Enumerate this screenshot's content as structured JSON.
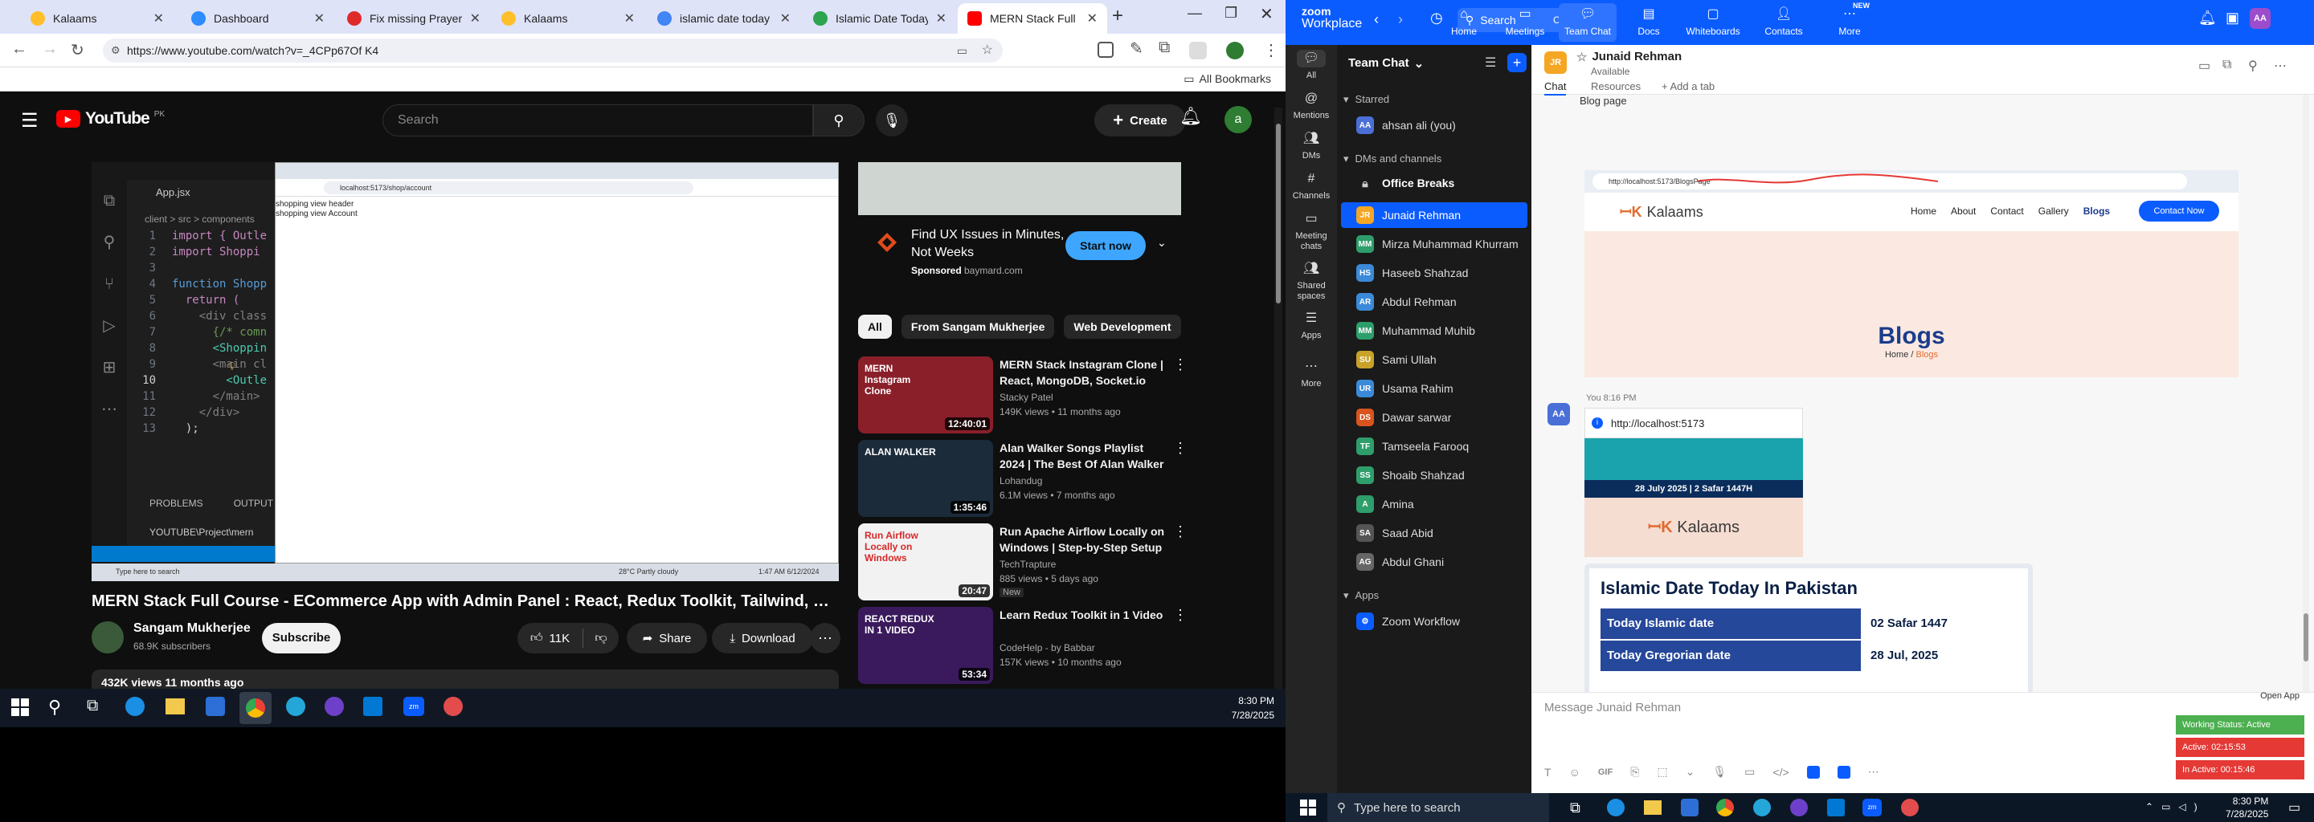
{
  "browser": {
    "tabs": [
      {
        "label": "Kalaams",
        "color": "#ffbf2a"
      },
      {
        "label": "Dashboard",
        "color": "#2d8cff"
      },
      {
        "label": "Fix missing PrayerTime",
        "color": "#e02a2a"
      },
      {
        "label": "Kalaams",
        "color": "#ffbf2a"
      },
      {
        "label": "islamic date today ne",
        "color": "#4285f4"
      },
      {
        "label": "Islamic Date Today - P",
        "color": "#2da44e"
      },
      {
        "label": "MERN Stack Full Cour",
        "color": "#ff0000"
      }
    ],
    "url": "https://www.youtube.com/watch?v=_4CPp67Of K4",
    "all_bookmarks": "All Bookmarks"
  },
  "youtube": {
    "logo": "YouTube",
    "country": "PK",
    "search_placeholder": "Search",
    "create_label": "Create",
    "avatar_letter": "a",
    "video": {
      "title": "MERN Stack Full Course - ECommerce App with Admin Panel : React, Redux Toolkit, Tailwind, MongoDB",
      "channel": "Sangam Mukherjee",
      "subscribers": "68.9K subscribers",
      "subscribe": "Subscribe",
      "likes": "11K",
      "share": "Share",
      "download": "Download",
      "views_age": "432K views  11 months ago"
    },
    "player": {
      "vscode_title": "App.jsx",
      "breadcrumb": "client > src > components",
      "line_numbers": [
        "1",
        "2",
        "3",
        "4",
        "5",
        "6",
        "7",
        "8",
        "9",
        "10",
        "11",
        "12",
        "13"
      ],
      "code": [
        "import { Outle",
        "import Shoppi",
        "",
        "function Shopp",
        "  return (",
        "    <div class",
        "      {/* comn",
        "      <Shoppin",
        "      <main cl",
        "        <Outle",
        "      </main>",
        "    </div>",
        "  );"
      ],
      "panel_tabs": [
        "PROBLEMS",
        "OUTPUT"
      ],
      "terminal": "YOUTUBE\\Project\\mern",
      "inner_url": "localhost:5173/shop/account",
      "page_lines": [
        "shopping view header",
        "shopping view Account"
      ],
      "weather": "28°C  Partly cloudy",
      "clock": "1:47 AM  6/12/2024"
    },
    "ad": {
      "title": "Find UX Issues in Minutes, Not Weeks",
      "sponsored": "Sponsored",
      "domain": "baymard.com",
      "cta": "Start now"
    },
    "chips": [
      "All",
      "From Sangam Mukherjee",
      "Web Development"
    ],
    "recommendations": [
      {
        "title": "MERN Stack Instagram Clone | React, MongoDB, Socket.io",
        "channel": "Stacky Patel",
        "meta": "149K views • 11 months ago",
        "duration": "12:40:01",
        "thumb_text": "MERN Instagram Clone",
        "thumb_color": "#8a1f2a",
        "badge": ""
      },
      {
        "title": "Alan Walker Songs Playlist 2024 | The Best Of Alan Walker | ...",
        "channel": "Lohandug",
        "meta": "6.1M views • 7 months ago",
        "duration": "1:35:46",
        "thumb_text": "ALAN WALKER",
        "thumb_color": "#1c2b3a",
        "badge": ""
      },
      {
        "title": "Run Apache Airflow Locally on Windows | Step-by-Step Setup ...",
        "channel": "TechTrapture",
        "meta": "885 views • 5 days ago",
        "duration": "20:47",
        "thumb_text": "Run Airflow Locally on Windows",
        "thumb_color": "#f2f2f2",
        "badge": "New"
      },
      {
        "title": "Learn Redux Toolkit in 1 Video",
        "channel": "CodeHelp - by Babbar",
        "meta": "157K views • 10 months ago",
        "duration": "53:34",
        "thumb_text": "REACT REDUX IN 1 VIDEO",
        "thumb_color": "#3a1a5c",
        "badge": ""
      }
    ]
  },
  "taskbar_left": {
    "time": "8:30 PM",
    "date": "7/28/2025"
  },
  "zoom": {
    "brand_top": "zoom",
    "brand_bottom": "Workplace",
    "search": "Search",
    "search_shortcut": "Ctrl+F",
    "nav": [
      "Home",
      "Meetings",
      "Team Chat",
      "Docs",
      "Whiteboards",
      "Contacts",
      "More"
    ],
    "nav_new_badge": "NEW",
    "rail": [
      "All",
      "Mentions",
      "DMs",
      "Channels",
      "Meeting chats",
      "Shared spaces",
      "Apps",
      "More"
    ],
    "panel_title": "Team Chat",
    "starred_header": "Starred",
    "starred_item": {
      "name": "ahsan ali (you)",
      "initials": "AA",
      "color": "#4a6fd6"
    },
    "dms_header": "DMs and channels",
    "office_breaks": "Office Breaks",
    "contacts": [
      {
        "name": "Junaid Rehman",
        "initials": "JR",
        "color": "#f5a623"
      },
      {
        "name": "Mirza Muhammad Khurram",
        "initials": "MM",
        "color": "#2e9e6b"
      },
      {
        "name": "Haseeb Shahzad",
        "initials": "HS",
        "color": "#3b8ad9"
      },
      {
        "name": "Abdul Rehman",
        "initials": "AR",
        "color": "#3b8ad9"
      },
      {
        "name": "Muhammad Muhib",
        "initials": "MM",
        "color": "#2e9e6b"
      },
      {
        "name": "Sami Ullah",
        "initials": "SU",
        "color": "#c9a227"
      },
      {
        "name": "Usama Rahim",
        "initials": "UR",
        "color": "#3b8ad9"
      },
      {
        "name": "Dawar sarwar",
        "initials": "DS",
        "color": "#d9541e"
      },
      {
        "name": "Tamseela Farooq",
        "initials": "TF",
        "color": "#2e9e6b"
      },
      {
        "name": "Shoaib Shahzad",
        "initials": "SS",
        "color": "#2e9e6b"
      },
      {
        "name": "Amina",
        "initials": "A",
        "color": "#2e9e6b"
      },
      {
        "name": "Saad Abid",
        "initials": "SA",
        "color": "#555555"
      },
      {
        "name": "Abdul Ghani",
        "initials": "AG",
        "color": "#666666"
      }
    ],
    "apps_header": "Apps",
    "apps_item": "Zoom Workflow",
    "chat": {
      "name": "Junaid Rehman",
      "initials": "JR",
      "status": "Available",
      "tabs": [
        "Chat",
        "Resources",
        "Add a tab"
      ],
      "top_partial": "Blog page",
      "site_url": "http://localhost:5173/BlogsPage",
      "site_logo": "Kalaams",
      "site_nav": [
        "Home",
        "About",
        "Contact",
        "Gallery",
        "Blogs"
      ],
      "contact_btn": "Contact Now",
      "banner_title": "Blogs",
      "banner_crumb_home": "Home",
      "banner_crumb_sep": "/",
      "banner_crumb_cur": "Blogs",
      "msg_initials": "AA",
      "msg_time": "You 8:16 PM",
      "link": "http://localhost:5173",
      "card_date": "28 July 2025 | 2 Safar 1447H",
      "card_logo": "Kalaams",
      "date_title": "Islamic Date Today In Pakistan",
      "rows": [
        {
          "label": "Today Islamic date",
          "value": "02 Safar 1447"
        },
        {
          "label": "Today Gregorian date",
          "value": "28 Jul, 2025"
        }
      ],
      "reaction_count": "1",
      "composer_placeholder": "Message Junaid Rehman"
    },
    "open_app": "Open App",
    "working_status": "Working Status: Active",
    "active_time": "Active: 02:15:53",
    "inactive_time": "In Active: 00:15:46",
    "colors": {
      "working": "#4caf50",
      "active": "#e53935",
      "inactive": "#e53935"
    }
  },
  "taskbar_right": {
    "search": "Type here to search",
    "time": "8:30 PM",
    "date": "7/28/2025"
  }
}
